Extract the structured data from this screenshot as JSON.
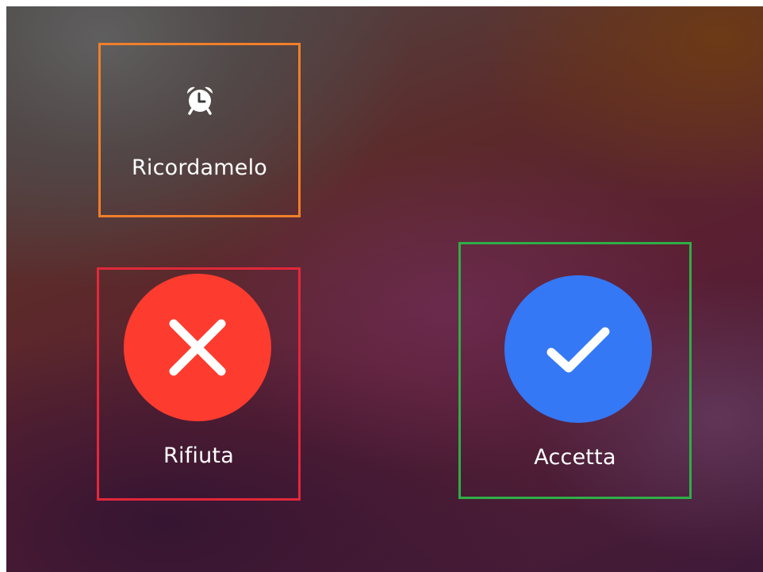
{
  "actions": {
    "remind": {
      "label": "Ricordamelo",
      "icon": "alarm-clock-icon"
    },
    "decline": {
      "label": "Rifiuta",
      "icon": "close-icon",
      "color": "#fe3b2f"
    },
    "accept": {
      "label": "Accetta",
      "icon": "checkmark-icon",
      "color": "#3478f6"
    }
  },
  "highlight_colors": {
    "remind": "#f07f2a",
    "decline": "#e2283a",
    "accept": "#2fae47"
  }
}
